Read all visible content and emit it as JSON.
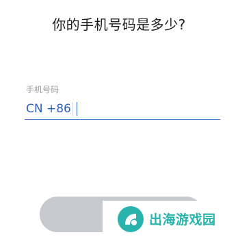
{
  "page": {
    "title": "你的手机号码是多少?"
  },
  "phone": {
    "label": "手机号码",
    "country_code": "CN +86"
  },
  "watermark": {
    "text": "出海游戏园"
  },
  "colors": {
    "accent": "#2e63b8",
    "underline": "#4a7dc9",
    "button_disabled": "#c6c9ce",
    "watermark": "#2ab3ad"
  }
}
